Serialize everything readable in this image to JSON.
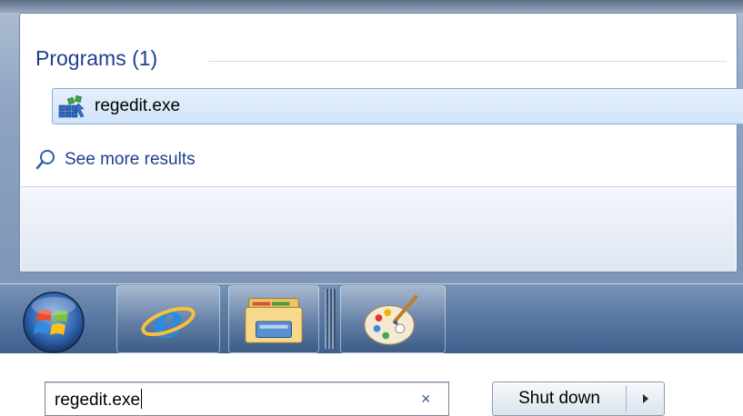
{
  "search_results": {
    "programs_header": "Programs (1)",
    "items": [
      {
        "label": "regedit.exe",
        "icon": "registry-editor-icon"
      }
    ],
    "see_more_label": "See more results"
  },
  "search": {
    "value": "regedit.exe",
    "clear_glyph": "×"
  },
  "power": {
    "shutdown_label": "Shut down"
  },
  "taskbar": {
    "pinned": [
      "internet-explorer-icon",
      "windows-explorer-icon",
      "paint-icon"
    ]
  },
  "colors": {
    "header_text": "#1e3f8f",
    "selection_border": "#84acdd",
    "taskbar": "#5c7aa4"
  }
}
